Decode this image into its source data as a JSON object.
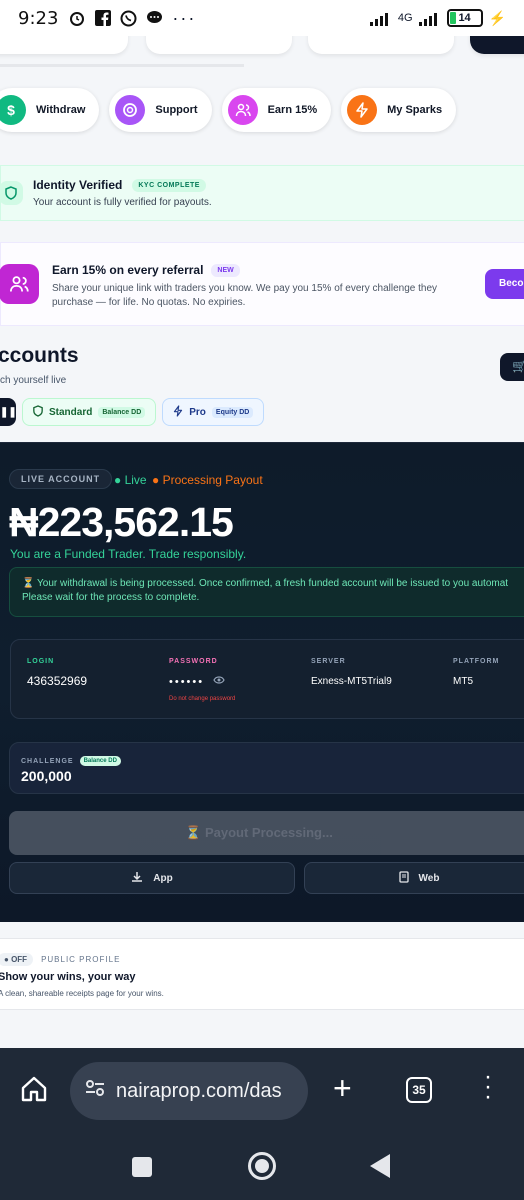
{
  "status_bar": {
    "time": "9:23",
    "network": "4G",
    "battery": "14"
  },
  "quick_actions": [
    {
      "label": "Withdraw",
      "icon": "dollar-icon",
      "color": "#10b981"
    },
    {
      "label": "Support",
      "icon": "lifebuoy-icon",
      "color": "#a855f7"
    },
    {
      "label": "Earn 15%",
      "icon": "users-icon",
      "color": "#d946ef"
    },
    {
      "label": "My Sparks",
      "icon": "bolt-icon",
      "color": "#f97316"
    }
  ],
  "kyc": {
    "title": "Identity Verified",
    "badge": "KYC COMPLETE",
    "subtitle": "Your account is fully verified for payouts."
  },
  "referral": {
    "title": "Earn 15% on every referral",
    "badge": "NEW",
    "description": "Share your unique link with traders you know. We pay you 15% of every challenge they purchase — for life. No quotas. No expiries.",
    "button": "Becor"
  },
  "accounts": {
    "title": "ccounts",
    "subtitle": "ch yourself live",
    "tabs": [
      {
        "label": "Standard",
        "badge": "Balance DD"
      },
      {
        "label": "Pro",
        "badge": "Equity DD"
      }
    ]
  },
  "live_account": {
    "label": "LIVE ACCOUNT",
    "status_live": "Live",
    "status_payout": "Processing Payout",
    "balance": "₦223,562.15",
    "message": "You are a Funded Trader. Trade responsibly.",
    "notice_line1": "⏳ Your withdrawal is being processed. Once confirmed, a fresh funded account will be issued to you automat",
    "notice_line2": "Please wait for the process to complete.",
    "credentials": {
      "login_label": "LOGIN",
      "login": "436352969",
      "password_label": "PASSWORD",
      "password": "••••••",
      "password_warning": "Do not change password",
      "server_label": "SERVER",
      "server": "Exness-MT5Trial9",
      "platform_label": "PLATFORM",
      "platform": "MT5"
    },
    "challenge_label": "CHALLENGE",
    "challenge_badge": "Balance DD",
    "challenge_value": "200,000",
    "payout_button": "⏳ Payout Processing...",
    "app_button": "App",
    "web_button": "Web"
  },
  "public_profile": {
    "toggle": "OFF",
    "label": "PUBLIC PROFILE",
    "title": "Show your wins, your way",
    "subtitle": "A clean, shareable receipts page for your wins."
  },
  "browser": {
    "url": "nairaprop.com/das",
    "tab_count": "35"
  }
}
